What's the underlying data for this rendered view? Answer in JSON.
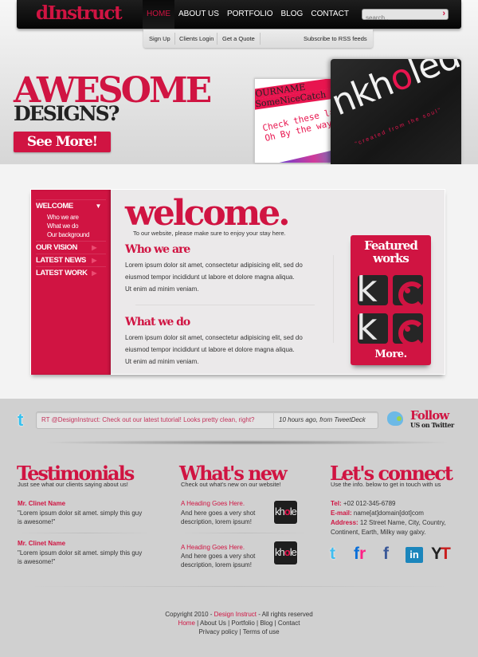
{
  "header": {
    "logo": "dInstruct",
    "nav": [
      {
        "label": "HOME",
        "active": true
      },
      {
        "label": "ABOUT US"
      },
      {
        "label": "PORTFOLIO"
      },
      {
        "label": "BLOG"
      },
      {
        "label": "CONTACT"
      }
    ],
    "search": {
      "placeholder": "search..",
      "go_icon": "›"
    },
    "subnav": [
      "Sign Up",
      "Clients Login",
      "Get a Quote"
    ],
    "rss": "Subscribe to RSS feeds"
  },
  "hero": {
    "title": "AWESOME",
    "subtitle": "DESIGNS?",
    "button": "See More!",
    "shot1": {
      "line1": "OURNAME",
      "line2": "SomeNiceCatch",
      "line3": "Check these la",
      "line4": "Oh By the way"
    },
    "shot2": {
      "word_a": "nkh",
      "word_o": "o",
      "word_b": "led",
      "tagline": "\"created from the soul\""
    }
  },
  "sidebar": {
    "items": [
      {
        "label": "WELCOME",
        "arrow": "▼"
      },
      {
        "label": "OUR VISION",
        "arrow": "▶"
      },
      {
        "label": "LATEST NEWS",
        "arrow": "▶"
      },
      {
        "label": "LATEST WORK",
        "arrow": "▶"
      }
    ],
    "subitems": [
      "Who we are",
      "What we do",
      "Our background"
    ]
  },
  "welcome": {
    "title": "welcome.",
    "subtitle": "To our website, please make sure to enjoy your stay here.",
    "sections": [
      {
        "heading": "Who we are",
        "lines": [
          "Lorem ipsum dolor sit amet, consectetur adipisicing elit, sed do",
          "eiusmod tempor incididunt ut labore et dolore magna aliqua.",
          "Ut enim ad minim veniam."
        ]
      },
      {
        "heading": "What we do",
        "lines": [
          "Lorem ipsum dolor sit amet, consectetur adipisicing elit, sed do",
          "eiusmod tempor incididunt ut labore et dolore magna aliqua.",
          "Ut enim ad minim veniam."
        ]
      }
    ]
  },
  "featured": {
    "title_1": "Featured",
    "title_2": "works",
    "more": "More."
  },
  "twitter": {
    "tweet": "RT @DesignInstruct: Check out our latest tutorial! Looks pretty clean, right?",
    "meta": "10 hours ago, from TweetDeck",
    "follow_1": "Follow",
    "follow_2": "US on Twitter"
  },
  "testimonials": {
    "title": "Testimonials",
    "subtitle": "Just see what our clients saying about us!",
    "items": [
      {
        "name": "Mr. Clinet Name",
        "line1": "\"Lorem ipsum dolor sit amet. simply this guy",
        "line2": "is awesome!\""
      },
      {
        "name": "Mr. Clinet Name",
        "line1": "\"Lorem ipsum dolor sit amet. simply this guy",
        "line2": "is awesome!\""
      }
    ]
  },
  "whats_new": {
    "title": "What's new",
    "subtitle": "Check out what's new on our website!",
    "items": [
      {
        "heading": "A Heading Goes Here.",
        "line1": "And here goes a very shot",
        "line2": "description, lorem ipsum!"
      },
      {
        "heading": "A Heading Goes Here.",
        "line1": "And here goes a very shot",
        "line2": "description, lorem ipsum!"
      }
    ]
  },
  "connect": {
    "title": "Let's connect",
    "subtitle": "Use the info. below to get in touch with us",
    "tel_label": "Tel:",
    "tel": "+02 012-345-6789",
    "email_label": "E-mail:",
    "email": "name[at]domain[dot]com",
    "address_label": "Address:",
    "address_1": "12 Street Name, City, Country,",
    "address_2": "Continent, Earth, Milky way galxy.",
    "social": [
      {
        "name": "twitter",
        "glyph": "t",
        "color": "#3fbdf0"
      },
      {
        "name": "flickr",
        "glyph": "fr",
        "color": "#0a6fd8"
      },
      {
        "name": "facebook",
        "glyph": "f",
        "color": "#3b5998"
      },
      {
        "name": "linkedin",
        "glyph": "in",
        "color": "#1b86bc"
      },
      {
        "name": "youtube",
        "glyph": "YT",
        "color": "#222222"
      }
    ]
  },
  "footer": {
    "copyright_pre": "Copyright 2010 - ",
    "brand": "Design Instruct",
    "copyright_post": " - All rights reserved",
    "links": [
      "Home",
      "About Us",
      "Portfolio",
      "Blog",
      "Contact"
    ],
    "links2": [
      "Privacy policy",
      "Terms of use"
    ],
    "sep": " | "
  },
  "colors": {
    "accent": "#d01442",
    "dark": "#0a0a0a",
    "panel": "#ebe9ea"
  }
}
